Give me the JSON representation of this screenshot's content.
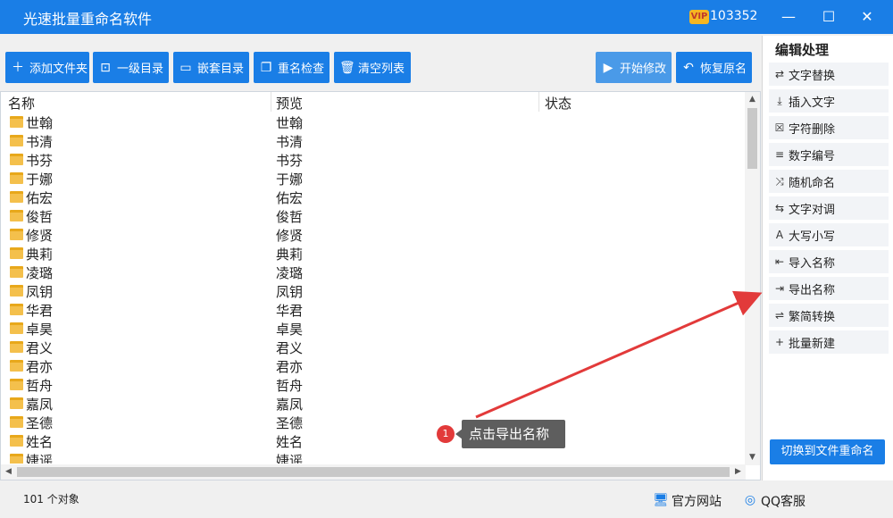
{
  "app": {
    "title": "光速批量重命名软件",
    "vip_badge": "VIP",
    "vip_number": "103352"
  },
  "window_controls": {
    "minimize": "—",
    "maximize": "☐",
    "close": "✕"
  },
  "toolbar": {
    "add_files": "添加文件夹",
    "level1_dir": "一级目录",
    "nested_dir": "嵌套目录",
    "rename_check": "重名检查",
    "clear_list": "清空列表",
    "start_modify": "开始修改",
    "restore_name": "恢复原名"
  },
  "list": {
    "columns": [
      "名称",
      "预览",
      "状态"
    ],
    "rows": [
      {
        "name": "世翰",
        "preview": "世翰"
      },
      {
        "name": "书清",
        "preview": "书清"
      },
      {
        "name": "书芬",
        "preview": "书芬"
      },
      {
        "name": "于娜",
        "preview": "于娜"
      },
      {
        "name": "佑宏",
        "preview": "佑宏"
      },
      {
        "name": "俊哲",
        "preview": "俊哲"
      },
      {
        "name": "修贤",
        "preview": "修贤"
      },
      {
        "name": "典莉",
        "preview": "典莉"
      },
      {
        "name": "凌璐",
        "preview": "凌璐"
      },
      {
        "name": "凤钥",
        "preview": "凤钥"
      },
      {
        "name": "华君",
        "preview": "华君"
      },
      {
        "name": "卓昊",
        "preview": "卓昊"
      },
      {
        "name": "君义",
        "preview": "君义"
      },
      {
        "name": "君亦",
        "preview": "君亦"
      },
      {
        "name": "哲舟",
        "preview": "哲舟"
      },
      {
        "name": "嘉凤",
        "preview": "嘉凤"
      },
      {
        "name": "圣德",
        "preview": "圣德"
      },
      {
        "name": "姓名",
        "preview": "姓名"
      },
      {
        "name": "婕谣",
        "preview": "婕谣"
      }
    ]
  },
  "side": {
    "heading": "编辑处理",
    "items": [
      {
        "label": "文字替换",
        "icon": "⇄"
      },
      {
        "label": "插入文字",
        "icon": "⤓"
      },
      {
        "label": "字符删除",
        "icon": "☒"
      },
      {
        "label": "数字编号",
        "icon": "≡"
      },
      {
        "label": "随机命名",
        "icon": "⤨"
      },
      {
        "label": "文字对调",
        "icon": "⇆"
      },
      {
        "label": "大写小写",
        "icon": "A"
      },
      {
        "label": "导入名称",
        "icon": "⇤"
      },
      {
        "label": "导出名称",
        "icon": "⇥"
      },
      {
        "label": "繁简转换",
        "icon": "⇌"
      },
      {
        "label": "批量新建",
        "icon": "+"
      }
    ],
    "switch_button": "切换到文件重命名"
  },
  "status": {
    "count": "101 个对象",
    "website": "官方网站",
    "qq_service": "QQ客服"
  },
  "annotation": {
    "badge": "1",
    "text": "点击导出名称"
  },
  "colors": {
    "accent": "#1a7ee6",
    "annotation_arrow": "#e23a3a"
  }
}
